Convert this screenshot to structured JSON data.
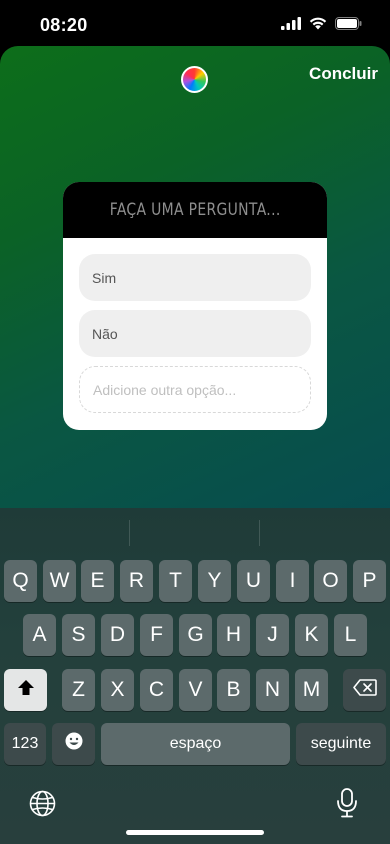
{
  "status_bar": {
    "time": "08:20"
  },
  "story": {
    "done_label": "Concluir",
    "poll": {
      "question_placeholder": "FAÇA UMA PERGUNTA...",
      "options": [
        "Sim",
        "Não"
      ],
      "add_option_placeholder": "Adicione outra opção..."
    }
  },
  "keyboard": {
    "row1": [
      "Q",
      "W",
      "E",
      "R",
      "T",
      "Y",
      "U",
      "I",
      "O",
      "P"
    ],
    "row2": [
      "A",
      "S",
      "D",
      "F",
      "G",
      "H",
      "J",
      "K",
      "L"
    ],
    "row3": [
      "Z",
      "X",
      "C",
      "V",
      "B",
      "N",
      "M"
    ],
    "numbers_label": "123",
    "space_label": "espaço",
    "return_label": "seguinte"
  }
}
